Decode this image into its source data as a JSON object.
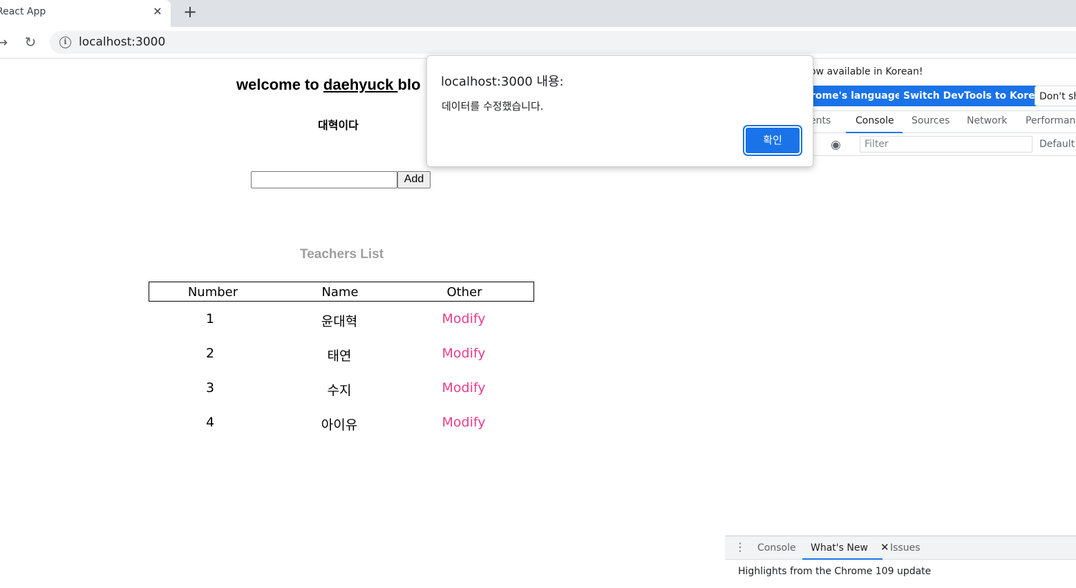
{
  "browser": {
    "tab_title": "React App",
    "tab_close": "✕",
    "new_tab": "+",
    "url": "localhost:3000"
  },
  "page": {
    "heading_prefix": "welcome to ",
    "heading_link": "daehyuck ",
    "heading_suffix": "blo",
    "subtitle": "대혁이다",
    "input_value": "",
    "add_label": "Add",
    "list_title": "Teachers List",
    "table": {
      "headers": [
        "Number",
        "Name",
        "Other"
      ],
      "rows": [
        {
          "number": "1",
          "name": "윤대혁",
          "action": "Modify"
        },
        {
          "number": "2",
          "name": "태연",
          "action": "Modify"
        },
        {
          "number": "3",
          "name": "수지",
          "action": "Modify"
        },
        {
          "number": "4",
          "name": "아이유",
          "action": "Modify"
        }
      ]
    }
  },
  "devtools": {
    "notice": "ow available in Korean!",
    "lang_btn_1": "rome's language",
    "lang_btn_2": "Switch DevTools to Korean",
    "lang_btn_3": "Don't sh",
    "tabs": [
      "ents",
      "Console",
      "Sources",
      "Network",
      "Performanc"
    ],
    "filter_placeholder": "Filter",
    "log_level": "Default",
    "drawer_tabs": [
      "Console",
      "What's New",
      "Issues"
    ],
    "drawer_close": "✕",
    "drawer_body": "Highlights from the Chrome 109 update"
  },
  "dialog": {
    "title": "localhost:3000 내용:",
    "message": "데이터를 수정했습니다.",
    "ok_label": "확인"
  },
  "colors": {
    "accent": "#1a73e8",
    "modify_link": "#e83e8c",
    "list_title": "#9e9e9e"
  }
}
